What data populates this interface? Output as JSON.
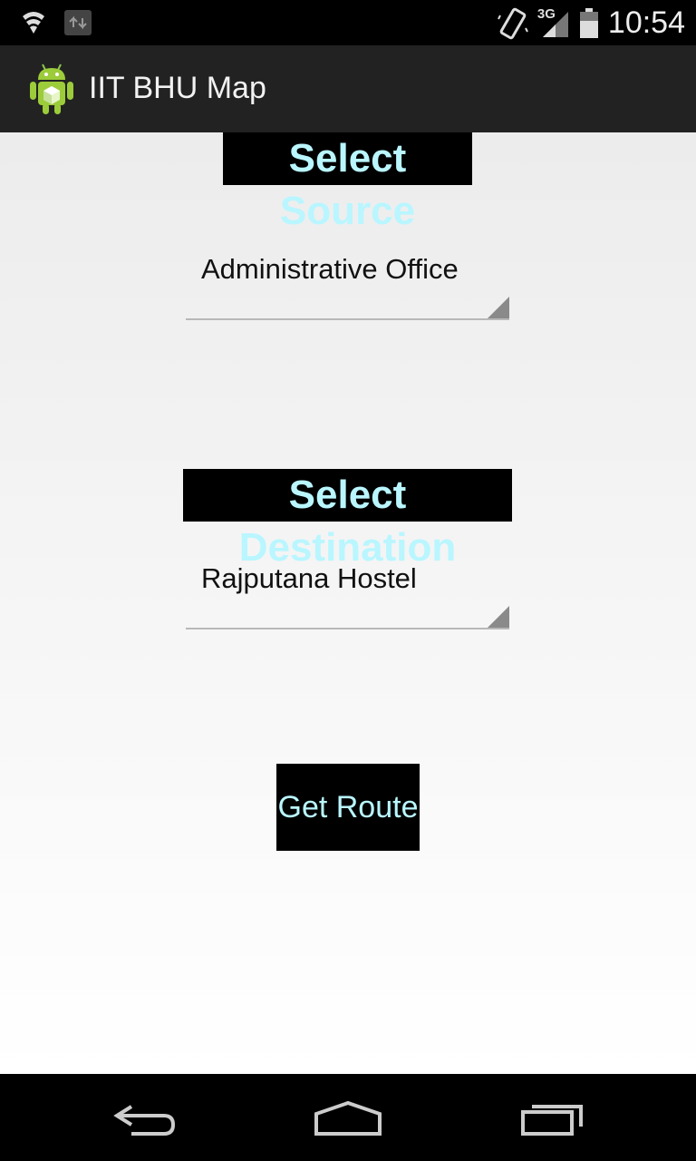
{
  "status_bar": {
    "time": "10:54",
    "network_label": "3G",
    "icons": [
      "shield-icon",
      "data-transfer-icon",
      "vibrate-icon",
      "signal-icon",
      "battery-icon"
    ]
  },
  "action_bar": {
    "title": "IIT BHU Map",
    "icon": "android-app-icon"
  },
  "form": {
    "source_label": "Select Source",
    "source_value": "Administrative Office",
    "destination_label": "Select Destination",
    "destination_value": "Rajputana Hostel",
    "get_route_label": "Get Route"
  },
  "colors": {
    "label_text": "#b9f6ff",
    "label_background": "#000000",
    "action_bar": "#222222"
  },
  "nav_bar": {
    "icons": [
      "back-icon",
      "home-icon",
      "recent-apps-icon"
    ]
  }
}
